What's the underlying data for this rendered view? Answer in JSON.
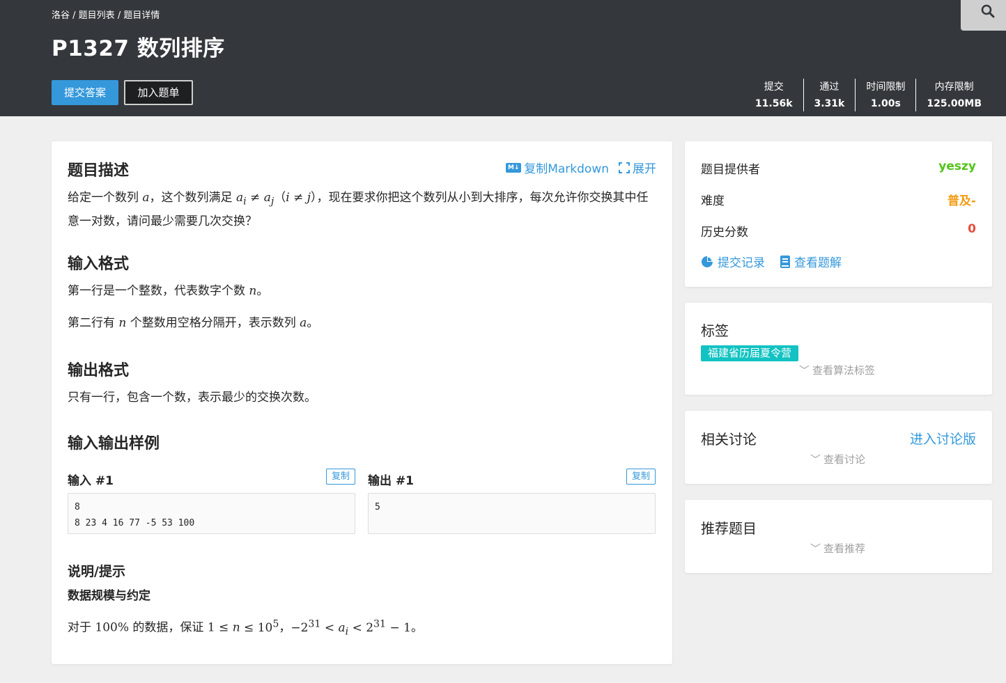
{
  "header": {
    "breadcrumb": [
      "洛谷",
      "题目列表",
      "题目详情"
    ],
    "title": "P1327 数列排序",
    "submit_label": "提交答案",
    "add_label": "加入题单",
    "stats": [
      {
        "label": "提交",
        "value": "11.56k"
      },
      {
        "label": "通过",
        "value": "3.31k"
      },
      {
        "label": "时间限制",
        "value": "1.00s"
      },
      {
        "label": "内存限制",
        "value": "125.00MB"
      }
    ]
  },
  "problem": {
    "desc_title": "题目描述",
    "copy_markdown": "复制Markdown",
    "expand": "展开",
    "input_title": "输入格式",
    "input_line1_pre": "第一行是一个整数，代表数字个数 ",
    "input_line1_var": "n",
    "input_line1_post": "。",
    "input_line2_pre": "第二行有 ",
    "input_line2_var": "n",
    "input_line2_mid": " 个整数用空格分隔开，表示数列 ",
    "input_line2_var2": "a",
    "input_line2_post": "。",
    "output_title": "输出格式",
    "output_text": "只有一行，包含一个数，表示最少的交换次数。",
    "samples_title": "输入输出样例",
    "input_sample_label": "输入 #1",
    "output_sample_label": "输出 #1",
    "copy_label": "复制",
    "input_sample": "8\n8 23 4 16 77 -5 53 100",
    "output_sample": "5",
    "hint_title": "说明/提示",
    "hint_subtitle": "数据规模与约定"
  },
  "sidebar": {
    "provider_label": "题目提供者",
    "provider": "yeszy",
    "difficulty_label": "难度",
    "difficulty": "普及-",
    "score_label": "历史分数",
    "score": "0",
    "records_link": "提交记录",
    "solutions_link": "查看题解",
    "tags_title": "标签",
    "tag": "福建省历届夏令营",
    "show_tags": "查看算法标签",
    "discuss_title": "相关讨论",
    "enter_discuss": "进入讨论版",
    "show_discuss": "查看讨论",
    "recommend_title": "推荐题目",
    "show_recommend": "查看推荐"
  },
  "colors": {
    "accent": "#3498db",
    "header_bg": "#34373b",
    "provider": "#52c41a",
    "difficulty": "#f39c11",
    "score": "#e74c3c",
    "tag": "#13c2c2"
  }
}
